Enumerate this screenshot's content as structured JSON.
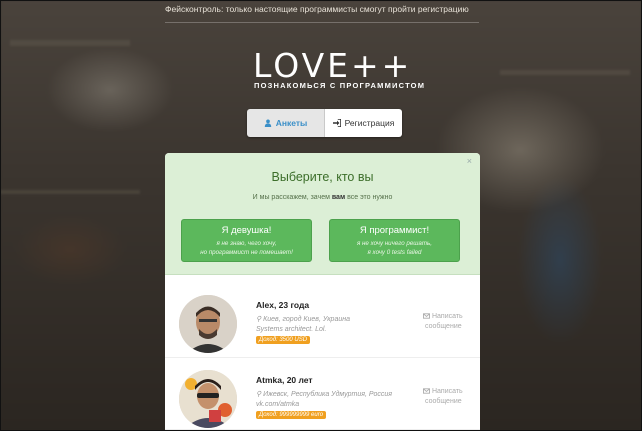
{
  "notice": "Фейсконтроль: только настоящие программисты смогут пройти регистрацию",
  "logo": "LOVE++",
  "tagline": "ПОЗНАКОМЬСЯ С ПРОГРАММИСТОМ",
  "tabs": [
    {
      "label": "Анкеты",
      "icon": "user-icon",
      "active": true
    },
    {
      "label": "Регистрация",
      "icon": "sign-in-icon",
      "active": false
    }
  ],
  "prompt": {
    "title": "Выберите, кто вы",
    "subtitle_before": "И мы расскажем, зачем ",
    "subtitle_bold": "вам",
    "subtitle_after": " все это нужно",
    "close": "×",
    "girl_button": {
      "label": "Я девушка!",
      "note1": "я не знаю, чего хочу,",
      "note2": "но программист не помешает!"
    },
    "programmer_button": {
      "label": "Я программист!",
      "note1": "я не хочу ничего решать,",
      "note2": "я хочу 0 tests failed"
    }
  },
  "profiles": [
    {
      "name": "Alex, 23 года",
      "location": "Киев, город Киев, Украина",
      "job": "Systems architect. Lol.",
      "income": "Доход: 3500 USD",
      "message": "Написать",
      "message2": "сообщение"
    },
    {
      "name": "Atmka, 20 лет",
      "location": "Ижевск, Республика Удмуртия, Россия",
      "job": "vk.com/atmka",
      "income": "Доход: 999999999 euro",
      "message": "Написать",
      "message2": "сообщение"
    }
  ],
  "colors": {
    "accent_green": "#5cb85c",
    "prompt_bg": "#dcefd6",
    "income_badge": "#f0a020",
    "tab_active_text": "#3a8fc8"
  }
}
